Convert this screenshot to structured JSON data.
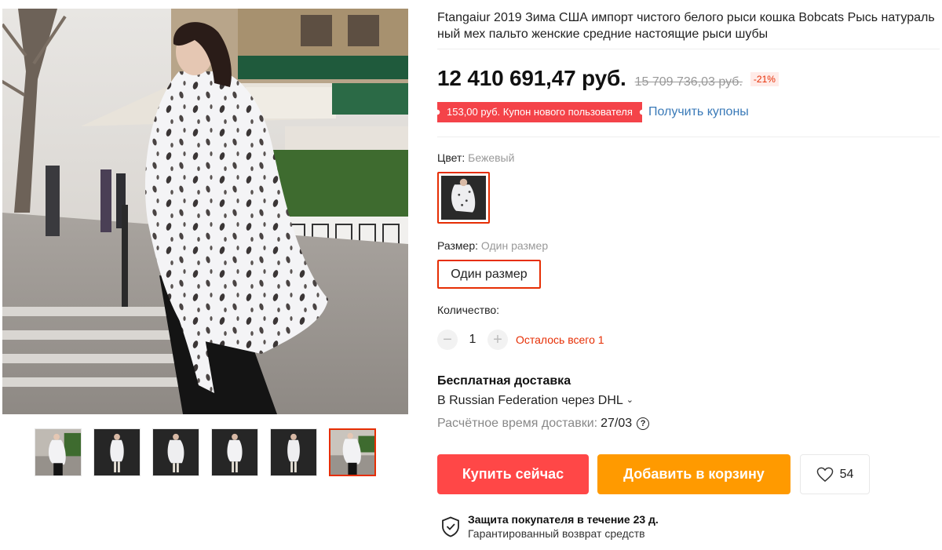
{
  "product": {
    "title": "Ftangaiur 2019 Зима США импорт чистого белого рыси кошка Bobcats Рысь натуральный мех пальто женские средние настоящие рыси шубы"
  },
  "pricing": {
    "price": "12 410 691,47 руб.",
    "old_price": "15 709 736,03 руб.",
    "discount": "-21%"
  },
  "coupon": {
    "badge": "153,00 руб. Купон нового пользователя",
    "link": "Получить купоны"
  },
  "color": {
    "label": "Цвет:",
    "value": "Бежевый"
  },
  "size": {
    "label": "Размер:",
    "value": "Один размер",
    "option": "Один размер"
  },
  "quantity": {
    "label": "Количество:",
    "value": "1",
    "stock": "Осталось всего 1"
  },
  "shipping": {
    "title": "Бесплатная доставка",
    "destination": "В Russian Federation через DHL",
    "time_label": "Расчётное время доставки:",
    "time_value": "27/03"
  },
  "actions": {
    "buy": "Купить сейчас",
    "cart": "Добавить в корзину",
    "wishlist_count": "54"
  },
  "protection": {
    "title": "Защита покупателя в течение 23 д.",
    "subtitle": "Гарантированный возврат средств"
  },
  "gallery": {
    "thumbnails_count": 6,
    "active_index": 5
  },
  "colors": {
    "accent": "#e62e04",
    "buy": "#ff4747",
    "cart": "#ff9a00",
    "link": "#3a7ab8"
  }
}
